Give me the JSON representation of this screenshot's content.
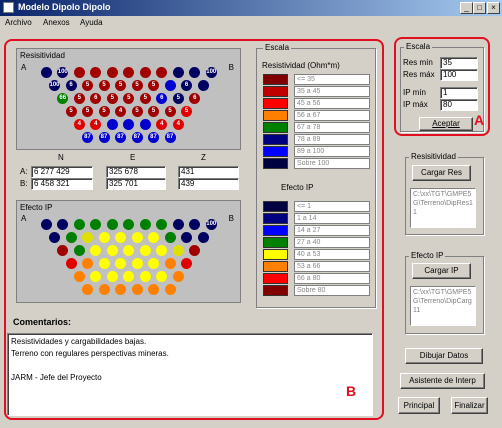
{
  "window": {
    "title": "Modelo Dipolo Dipolo",
    "minimize": "_",
    "maximize": "□",
    "close": "×"
  },
  "menu": [
    "Archivo",
    "Anexos",
    "Ayuda"
  ],
  "resistividad_plot": {
    "title": "Resisitividad",
    "left": "A",
    "right": "B",
    "rows": [
      {
        "colors": [
          "#000060",
          "#000060",
          "#a00000",
          "#a00000",
          "#a00000",
          "#a00000",
          "#a00000",
          "#a00000",
          "#000060",
          "#000060",
          "#000060"
        ],
        "labels": [
          "",
          "100",
          "",
          "",
          "",
          "",
          "",
          "",
          "",
          "",
          "100"
        ]
      },
      {
        "colors": [
          "#000060",
          "#000060",
          "#a00000",
          "#a00000",
          "#a00000",
          "#a00000",
          "#a00000",
          "#0000d0",
          "#000060",
          "#000060"
        ],
        "labels": [
          "100",
          "6",
          "5",
          "5",
          "5",
          "5",
          "5",
          "",
          "6",
          ""
        ]
      },
      {
        "colors": [
          "#008000",
          "#a00000",
          "#a00000",
          "#a00000",
          "#a00000",
          "#a00000",
          "#0000d0",
          "#000060",
          "#a00000"
        ],
        "labels": [
          "66",
          "5",
          "6",
          "5",
          "5",
          "5",
          "6",
          "5",
          "6"
        ]
      },
      {
        "colors": [
          "#a00000",
          "#a00000",
          "#a00000",
          "#a00000",
          "#a00000",
          "#a00000",
          "#a00000",
          "#e00000"
        ],
        "labels": [
          "5",
          "5",
          "5",
          "4",
          "5",
          "5",
          "5",
          "5"
        ]
      },
      {
        "colors": [
          "#e00000",
          "#e00000",
          "#0000d0",
          "#0000d0",
          "#0000d0",
          "#e00000",
          "#e00000"
        ],
        "labels": [
          "4",
          "4",
          "",
          "",
          "",
          "4",
          "4"
        ]
      },
      {
        "colors": [
          "#0000d0",
          "#0000d0",
          "#0000d0",
          "#0000d0",
          "#0000d0",
          "#0000d0"
        ],
        "labels": [
          "87",
          "87",
          "87",
          "87",
          "87",
          "87"
        ]
      }
    ]
  },
  "coords": {
    "headers": [
      "N",
      "E",
      "Z"
    ],
    "rowA": "A:",
    "rowB": "B:",
    "A": [
      "6 277 429",
      "325 678",
      "431"
    ],
    "B": [
      "6 458 321",
      "325 701",
      "439"
    ]
  },
  "ip_plot": {
    "title": "Efecto IP",
    "left": "A",
    "right": "B",
    "rows": [
      {
        "colors": [
          "#000060",
          "#000060",
          "#008000",
          "#008000",
          "#008000",
          "#008000",
          "#008000",
          "#008000",
          "#000060",
          "#000060",
          "#000060"
        ],
        "labels": [
          "",
          "",
          "",
          "",
          "",
          "",
          "",
          "",
          "",
          "",
          "100"
        ]
      },
      {
        "colors": [
          "#000060",
          "#008000",
          "#e0e000",
          "#ffff00",
          "#ffff00",
          "#ffff00",
          "#ffff00",
          "#008000",
          "#000060",
          "#000060"
        ],
        "labels": [
          "",
          "",
          "",
          "",
          "",
          "",
          "",
          "",
          "",
          ""
        ]
      },
      {
        "colors": [
          "#a00000",
          "#008000",
          "#ffff00",
          "#ffff00",
          "#ffff00",
          "#ffff00",
          "#ffff00",
          "#e0e000",
          "#a00000"
        ],
        "labels": [
          "",
          "",
          "",
          "",
          "",
          "",
          "",
          "",
          ""
        ]
      },
      {
        "colors": [
          "#e00000",
          "#ff8000",
          "#ffff00",
          "#ffff00",
          "#ffff00",
          "#ffff00",
          "#ff8000",
          "#e00000"
        ],
        "labels": [
          "",
          "",
          "",
          "",
          "",
          "",
          "",
          ""
        ]
      },
      {
        "colors": [
          "#ff8000",
          "#ffff00",
          "#ffff00",
          "#ffff00",
          "#ffff00",
          "#ffff00",
          "#ff8000"
        ],
        "labels": [
          "",
          "",
          "",
          "",
          "",
          "",
          ""
        ]
      },
      {
        "colors": [
          "#ff8000",
          "#ff8000",
          "#ff8000",
          "#ff8000",
          "#ff8000",
          "#ff8000"
        ],
        "labels": [
          "",
          "",
          "",
          "",
          "",
          ""
        ]
      }
    ]
  },
  "comentarios": {
    "label": "Comentarios:",
    "text": "Resistividades y cargabilidades bajas.\nTerreno con regulares perspectivas mineras.\n\nJARM - Jefe del Proyecto"
  },
  "escala": {
    "title": "Escala",
    "res_title": "Resistividad (Ohm*m)",
    "res": [
      {
        "color": "#800000",
        "label": "<= 35"
      },
      {
        "color": "#c00000",
        "label": "35 a 45"
      },
      {
        "color": "#ff0000",
        "label": "45 a 56"
      },
      {
        "color": "#ff8000",
        "label": "56 a 67"
      },
      {
        "color": "#008000",
        "label": "67 a 78"
      },
      {
        "color": "#000080",
        "label": "78 a 89"
      },
      {
        "color": "#0000ff",
        "label": "89 a 100"
      },
      {
        "color": "#000040",
        "label": "Sobre 100"
      }
    ],
    "ip_title": "Efecto IP",
    "ip": [
      {
        "color": "#000040",
        "label": "<= 1"
      },
      {
        "color": "#000080",
        "label": "1 a 14"
      },
      {
        "color": "#0000ff",
        "label": "14 a 27"
      },
      {
        "color": "#008000",
        "label": "27 a 40"
      },
      {
        "color": "#ffff00",
        "label": "40 a 53"
      },
      {
        "color": "#ff8000",
        "label": "53 a 66"
      },
      {
        "color": "#ff0000",
        "label": "66 a 80"
      },
      {
        "color": "#800000",
        "label": "Sobre 80"
      }
    ]
  },
  "right": {
    "escala_title": "Escala",
    "res_min_label": "Res mín",
    "res_min": "35",
    "res_max_label": "Res máx",
    "res_max": "100",
    "ip_min_label": "IP mín",
    "ip_min": "1",
    "ip_max_label": "IP máx",
    "ip_max": "80",
    "aceptar": "Aceptar",
    "res_group": "Resisitividad",
    "cargar_res": "Cargar Res",
    "res_path": "C:\\xx\\TGT\\GMPE5G\\Terreno\\DipRes11",
    "ip_group": "Efecto IP",
    "cargar_ip": "Cargar IP",
    "ip_path": "C:\\xx\\TGT\\GMPE5G\\Terreno\\DipCarg11",
    "dibujar": "Dibujar Datos",
    "asistente": "Asistente de Interp",
    "principal": "Principal",
    "finalizar": "Finalizar"
  },
  "annotations": {
    "a": "A",
    "b": "B"
  },
  "colors": {
    "accent_red": "#e01020",
    "title_blue": "#0a246a",
    "face": "#d4d0c8"
  }
}
